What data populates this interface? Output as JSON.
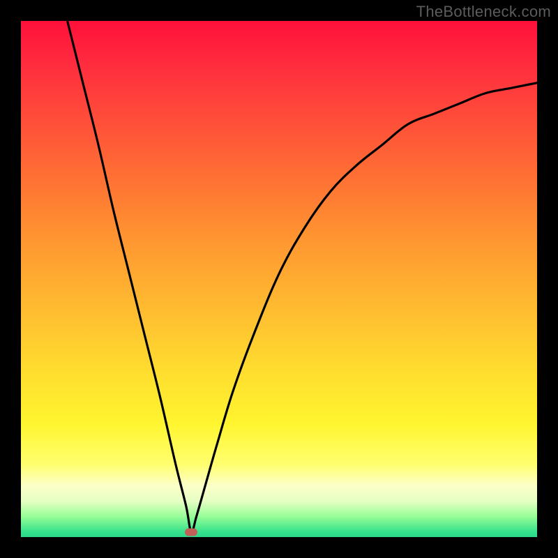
{
  "watermark": "TheBottleneck.com",
  "colors": {
    "frame": "#000000",
    "curve": "#000000",
    "marker": "#c06058",
    "watermark": "#5c5c5c"
  },
  "chart_data": {
    "type": "line",
    "title": "",
    "xlabel": "",
    "ylabel": "",
    "xlim": [
      0,
      100
    ],
    "ylim": [
      0,
      100
    ],
    "grid": false,
    "legend": false,
    "annotations": [
      {
        "type": "marker",
        "x": 33,
        "y": 1,
        "shape": "pill",
        "color": "#c06058"
      }
    ],
    "series": [
      {
        "name": "bottleneck-curve",
        "color": "#000000",
        "x": [
          9,
          12,
          15,
          18,
          21,
          24,
          27,
          30,
          32,
          33,
          34,
          36,
          38,
          41,
          45,
          50,
          55,
          60,
          65,
          70,
          75,
          80,
          85,
          90,
          95,
          100
        ],
        "y": [
          100,
          88,
          76,
          63,
          51,
          39,
          27,
          14,
          6,
          1,
          4,
          11,
          18,
          28,
          39,
          51,
          60,
          67,
          72,
          76,
          80,
          82,
          84,
          86,
          87,
          88
        ]
      }
    ]
  }
}
